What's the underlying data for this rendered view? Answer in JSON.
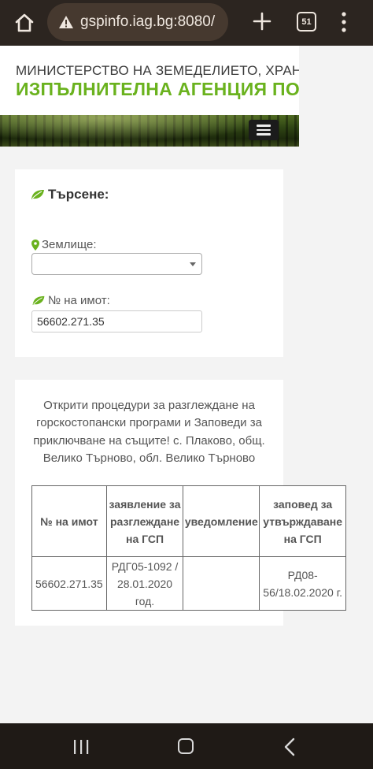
{
  "browser": {
    "url": "gspinfo.iag.bg:8080/",
    "tab_count": "51"
  },
  "header": {
    "ministry": "МИНИСТЕРСТВО НА ЗЕМЕДЕЛИЕТО, ХРАНИТЕ И ГОРИТЕ",
    "agency": "ИЗПЪЛНИТЕЛНА АГЕНЦИЯ ПО ГОРИТЕ"
  },
  "search": {
    "title": "Търсене:",
    "zemlishte_label": "Землище:",
    "zemlishte_value": "",
    "parcel_label": "№ на имот:",
    "parcel_value": "56602.271.35"
  },
  "results": {
    "heading": "Открити процедури за разглеждане на горскостопански програми и Заповеди за приключване на същите! с. Плаково, общ. Велико Търново, обл. Велико Търново",
    "columns": [
      "№ на имот",
      "заявление за разглеждане на ГСП",
      "уведомление",
      "заповед за утвърждаване на ГСП"
    ],
    "rows": [
      [
        "56602.271.35",
        "РДГ05-1092 / 28.01.2020 год.",
        "",
        "РД08-56/18.02.2020 г."
      ]
    ]
  },
  "colors": {
    "accent_green": "#6ab21e",
    "browser_bar": "#2c2520",
    "nav_bar": "#1f1a16"
  },
  "icons": {
    "home": "home-icon",
    "info": "info-icon",
    "new_tab": "plus-icon",
    "tabs": "tab-switcher-icon",
    "menu": "kebab-menu-icon",
    "hamburger": "hamburger-icon",
    "leaf": "leaf-icon",
    "pin": "map-marker-icon"
  }
}
